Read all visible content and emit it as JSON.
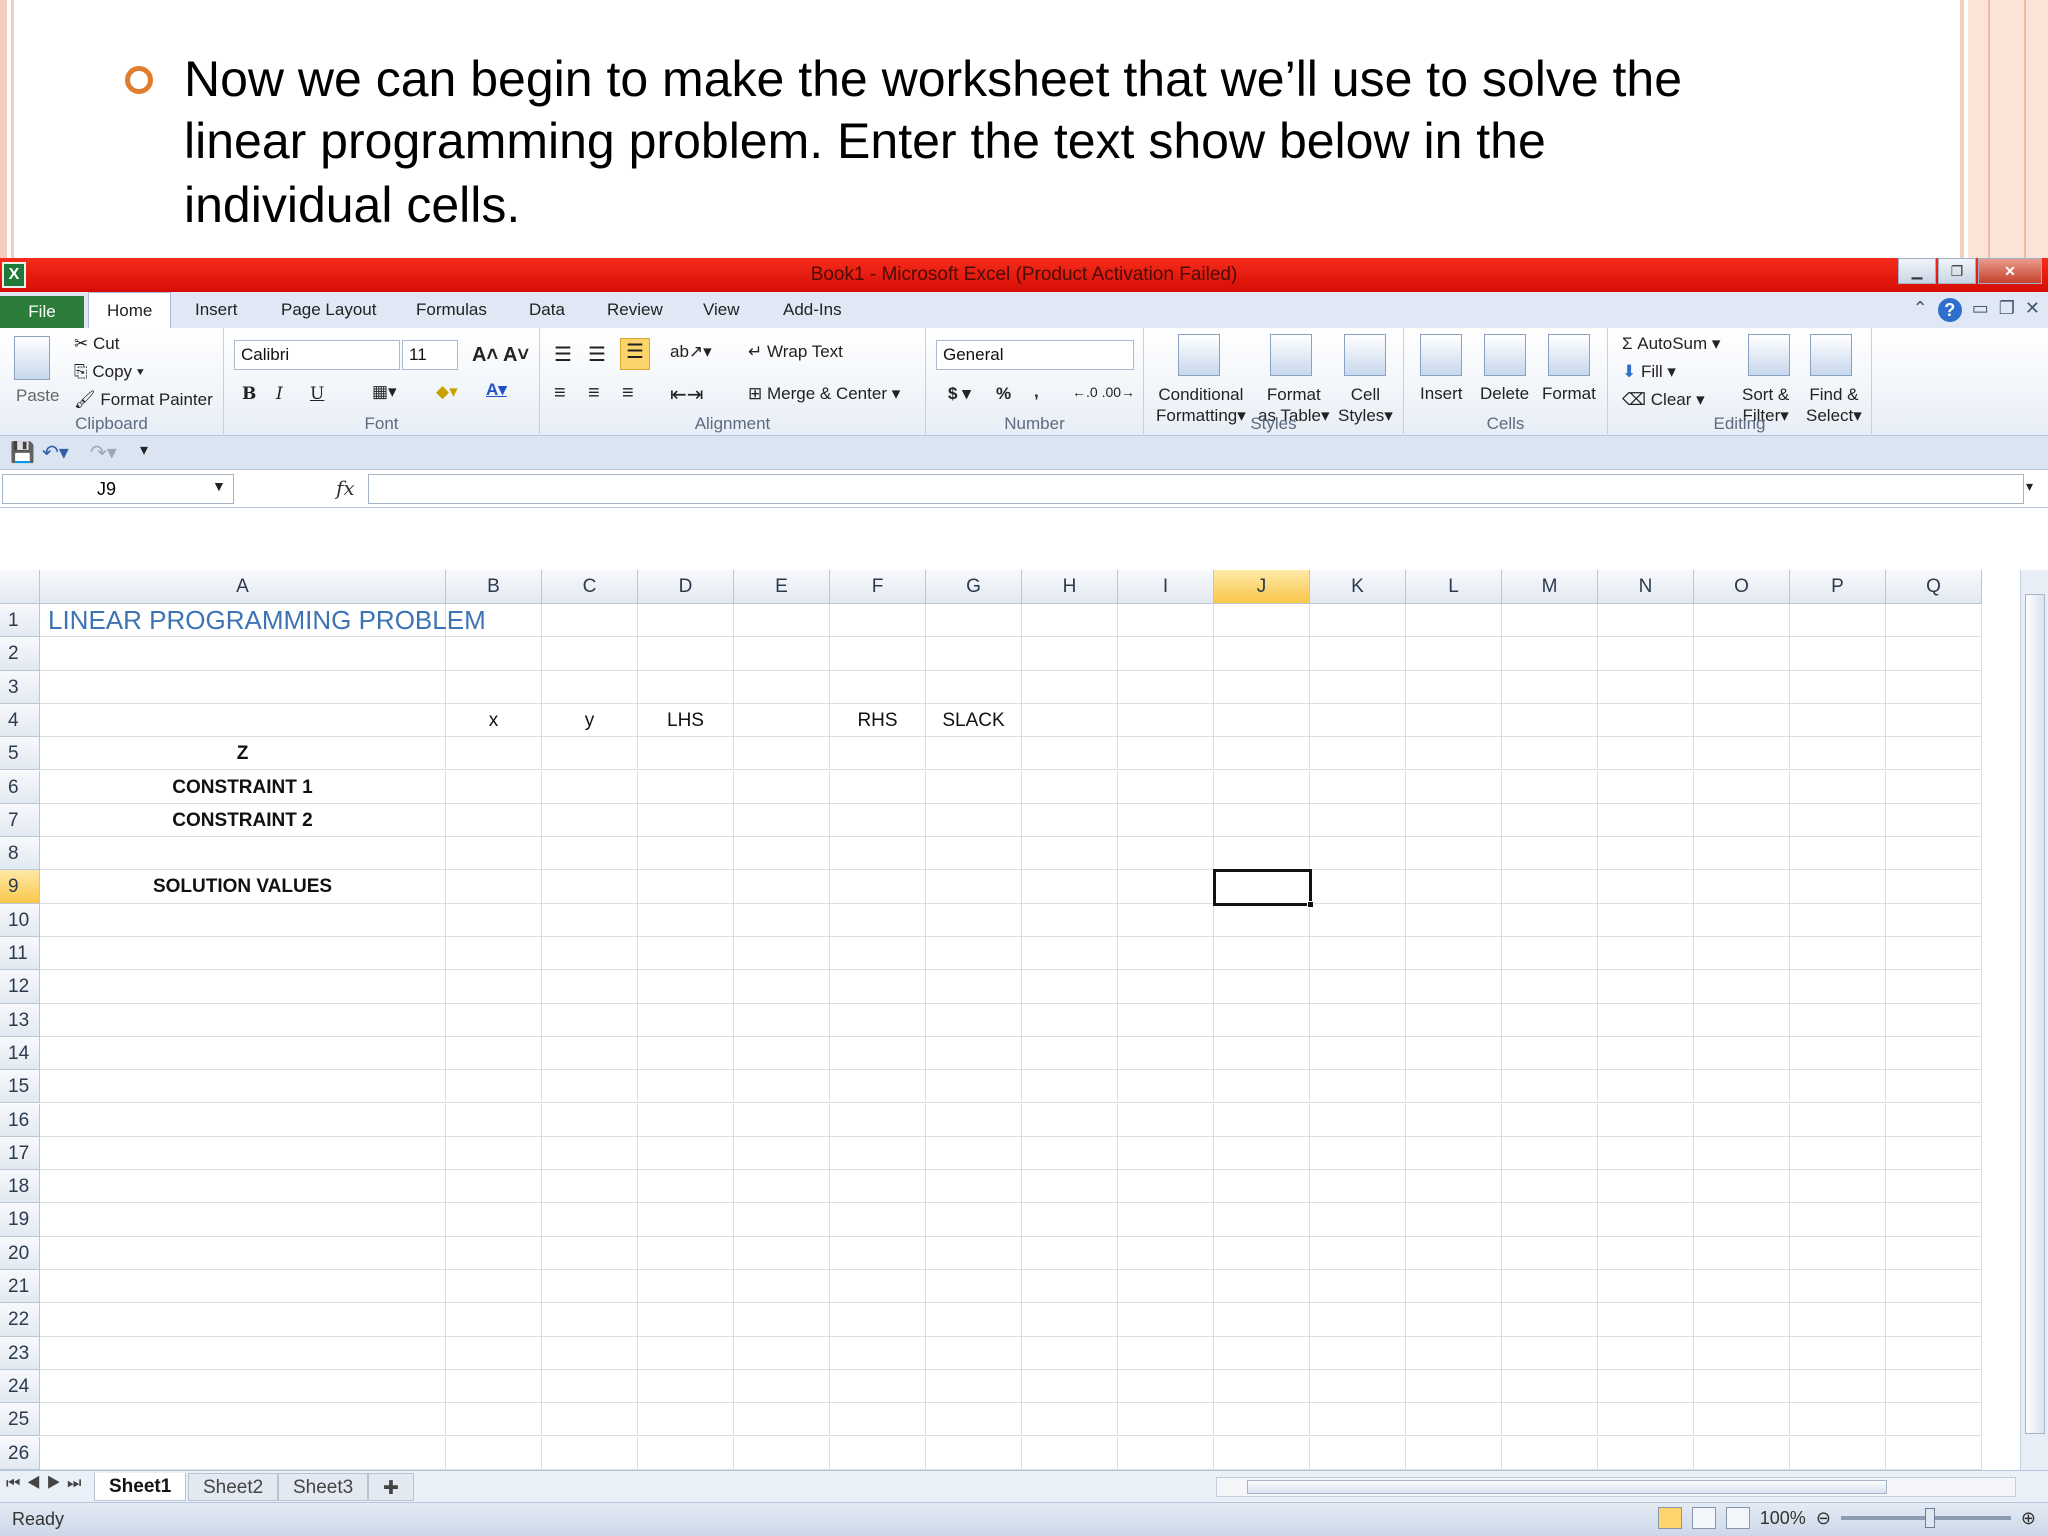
{
  "slide": {
    "lines": [
      "Now we can begin to make the worksheet that we’ll use to solve the",
      "linear programming problem. Enter the text show below in the",
      "individual cells."
    ],
    "accent_color": "#e07d2c"
  },
  "window": {
    "title": "Book1  -  Microsoft Excel (Product Activation Failed)",
    "app_icon": "X",
    "titlebar_color": "#e8190e"
  },
  "tabs": {
    "file": "File",
    "items": [
      "Home",
      "Insert",
      "Page Layout",
      "Formulas",
      "Data",
      "Review",
      "View",
      "Add-Ins"
    ],
    "active": "Home"
  },
  "ribbon": {
    "clipboard": {
      "paste": "Paste",
      "cut": "Cut",
      "copy": "Copy",
      "format_painter": "Format Painter",
      "label": "Clipboard"
    },
    "font": {
      "name": "Calibri",
      "size": "11",
      "bold": "B",
      "italic": "I",
      "underline": "U",
      "label": "Font"
    },
    "alignment": {
      "wrap_text": "Wrap Text",
      "merge_center": "Merge & Center",
      "label": "Alignment"
    },
    "number": {
      "format": "General",
      "currency": "$",
      "percent": "%",
      "comma": ",",
      "label": "Number"
    },
    "styles": {
      "conditional_1": "Conditional",
      "conditional_2": "Formatting",
      "format_table_1": "Format",
      "format_table_2": "as Table",
      "cell_styles_1": "Cell",
      "cell_styles_2": "Styles",
      "label": "Styles"
    },
    "cells": {
      "insert": "Insert",
      "delete": "Delete",
      "format": "Format",
      "label": "Cells"
    },
    "editing": {
      "autosum": "AutoSum",
      "fill": "Fill",
      "clear": "Clear",
      "sort_1": "Sort &",
      "sort_2": "Filter",
      "find_1": "Find &",
      "find_2": "Select",
      "label": "Editing"
    }
  },
  "formula_bar": {
    "name_box": "J9",
    "fx": "fx",
    "value": ""
  },
  "grid": {
    "columns": [
      "A",
      "B",
      "C",
      "D",
      "E",
      "F",
      "G",
      "H",
      "I",
      "J",
      "K",
      "L",
      "M",
      "N",
      "O",
      "P",
      "Q"
    ],
    "rows": [
      "1",
      "2",
      "3",
      "4",
      "5",
      "6",
      "7",
      "8",
      "9",
      "10",
      "11",
      "12",
      "13",
      "14",
      "15",
      "16",
      "17",
      "18",
      "19",
      "20",
      "21",
      "22",
      "23",
      "24",
      "25",
      "26"
    ],
    "selected_column": "J",
    "selected_row": "9",
    "cells": {
      "A1": "LINEAR PROGRAMMING PROBLEM",
      "B4": "x",
      "C4": "y",
      "D4": "LHS",
      "F4": "RHS",
      "G4": "SLACK",
      "A5": "Z",
      "A6": "CONSTRAINT 1",
      "A7": "CONSTRAINT 2",
      "A9": "SOLUTION VALUES"
    }
  },
  "sheets": {
    "tabs": [
      "Sheet1",
      "Sheet2",
      "Sheet3"
    ],
    "active": "Sheet1"
  },
  "status": {
    "text": "Ready",
    "zoom": "100%"
  }
}
